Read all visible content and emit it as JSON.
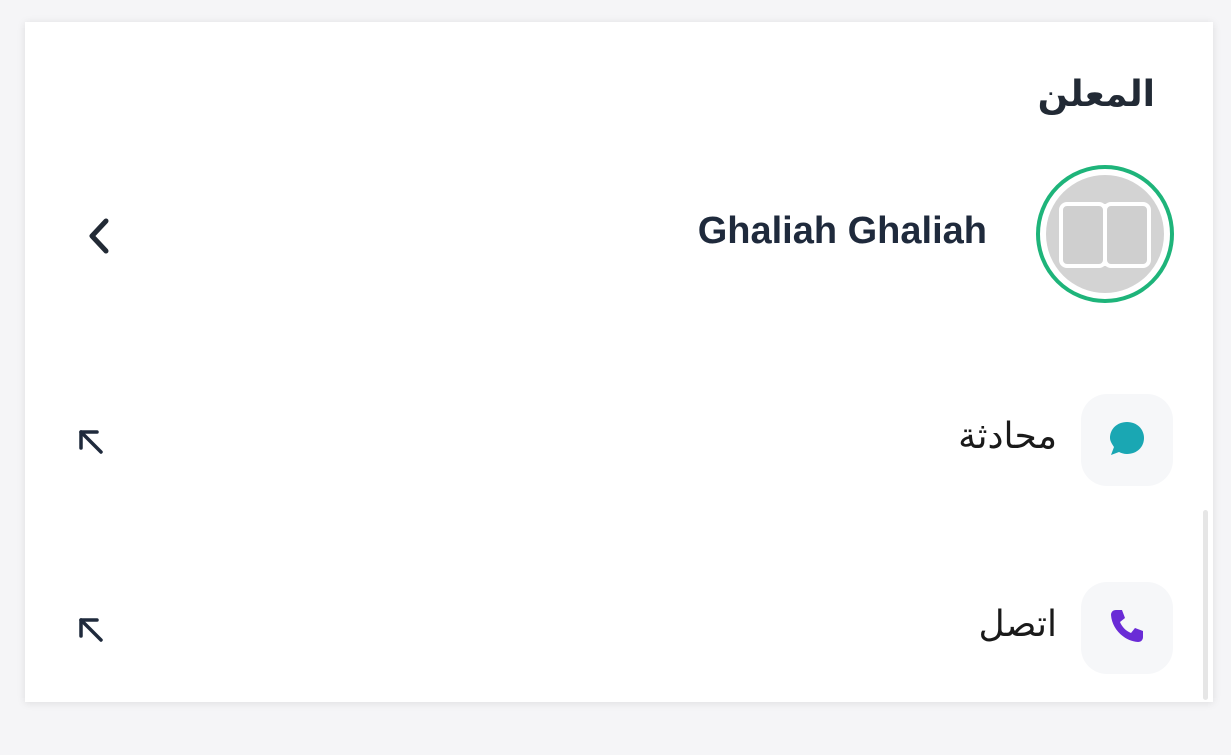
{
  "advertiser_section": {
    "title": "المعلن",
    "name": "Ghaliah Ghaliah",
    "avatar_border_color": "#1eb47a"
  },
  "actions": [
    {
      "label": "محادثة",
      "icon": "chat-bubble-icon",
      "icon_color": "#1aa7b3"
    },
    {
      "label": "اتصل",
      "icon": "phone-icon",
      "icon_color": "#6a2bd6"
    }
  ],
  "icons": {
    "back": "chevron-left-icon",
    "row_arrow": "arrow-up-left-icon"
  }
}
